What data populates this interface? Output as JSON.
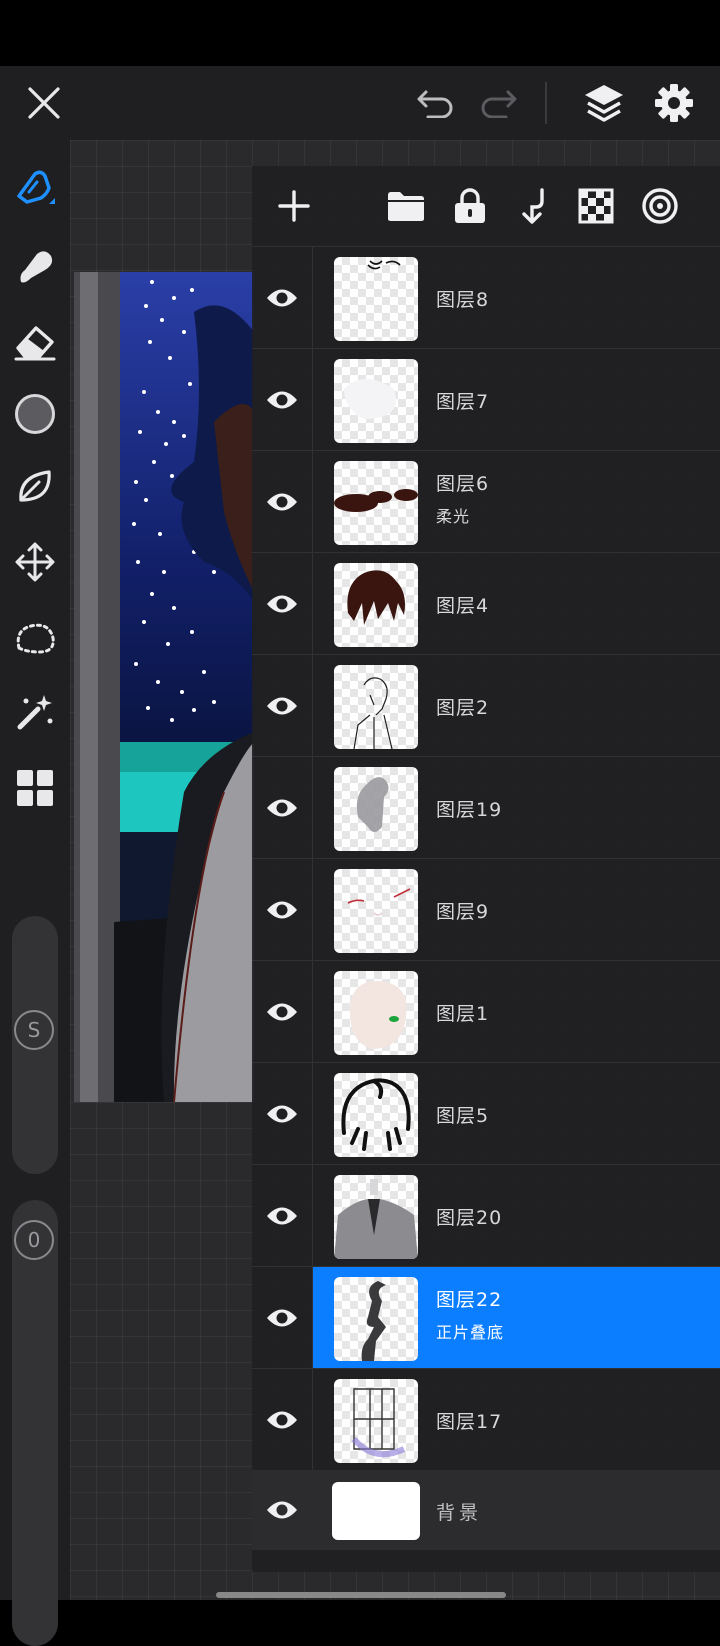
{
  "top_bar": {
    "close_icon": "close-icon",
    "undo_icon": "undo-icon",
    "redo_icon": "redo-icon",
    "layers_icon": "layers-icon",
    "settings_icon": "gear-icon"
  },
  "left_toolbar": {
    "tools": [
      "brush",
      "smudge",
      "eraser",
      "color",
      "shape",
      "transform",
      "lasso",
      "magic-wand",
      "gallery"
    ],
    "size_slider_label": "S",
    "opacity_slider_label": "0"
  },
  "layers_panel": {
    "toolbar_icons": [
      "add-icon",
      "folder-icon",
      "lock-icon",
      "merge-down-icon",
      "alpha-lock-icon",
      "reference-icon"
    ],
    "layers": [
      {
        "name": "图层8",
        "mode": "",
        "visible": true,
        "selected": false
      },
      {
        "name": "图层7",
        "mode": "",
        "visible": true,
        "selected": false
      },
      {
        "name": "图层6",
        "mode": "柔光",
        "visible": true,
        "selected": false
      },
      {
        "name": "图层4",
        "mode": "",
        "visible": true,
        "selected": false
      },
      {
        "name": "图层2",
        "mode": "",
        "visible": true,
        "selected": false
      },
      {
        "name": "图层19",
        "mode": "",
        "visible": true,
        "selected": false
      },
      {
        "name": "图层9",
        "mode": "",
        "visible": true,
        "selected": false
      },
      {
        "name": "图层1",
        "mode": "",
        "visible": true,
        "selected": false
      },
      {
        "name": "图层5",
        "mode": "",
        "visible": true,
        "selected": false
      },
      {
        "name": "图层20",
        "mode": "",
        "visible": true,
        "selected": false
      },
      {
        "name": "图层22",
        "mode": "正片叠底",
        "visible": true,
        "selected": true
      },
      {
        "name": "图层17",
        "mode": "",
        "visible": true,
        "selected": false
      }
    ],
    "background_layer": {
      "name": "背景",
      "visible": true
    }
  },
  "colors": {
    "accent": "#0b7dff",
    "panel": "#202022",
    "toolbar": "#1f1f21",
    "current_color": "#5c5c60"
  }
}
